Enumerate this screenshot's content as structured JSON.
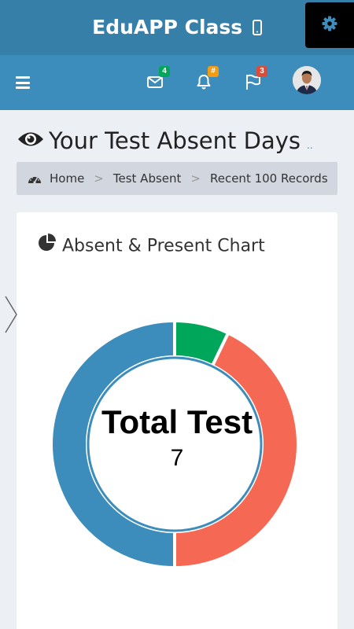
{
  "app": {
    "title": "EduAPP Class"
  },
  "navbar": {
    "mail_badge": "4",
    "bell_badge": "#",
    "flag_badge": "3",
    "colors": {
      "mail_badge": "#00a65a",
      "bell_badge": "#f39c12",
      "flag_badge": "#dd4b39"
    }
  },
  "page": {
    "title": "Your Test Absent Days",
    "subtitle": ".."
  },
  "breadcrumb": {
    "items": [
      "Home",
      "Test Absent",
      "Recent 100 Records"
    ]
  },
  "box": {
    "title": "Absent & Present Chart"
  },
  "chart_data": {
    "type": "pie",
    "variant": "doughnut",
    "center_title": "Total Test",
    "center_value": "7",
    "slices": [
      {
        "value": 0.5,
        "color": "#00a65a"
      },
      {
        "value": 3,
        "color": "#f56954"
      },
      {
        "value": 3.5,
        "color": "#3c8dbc"
      }
    ]
  }
}
